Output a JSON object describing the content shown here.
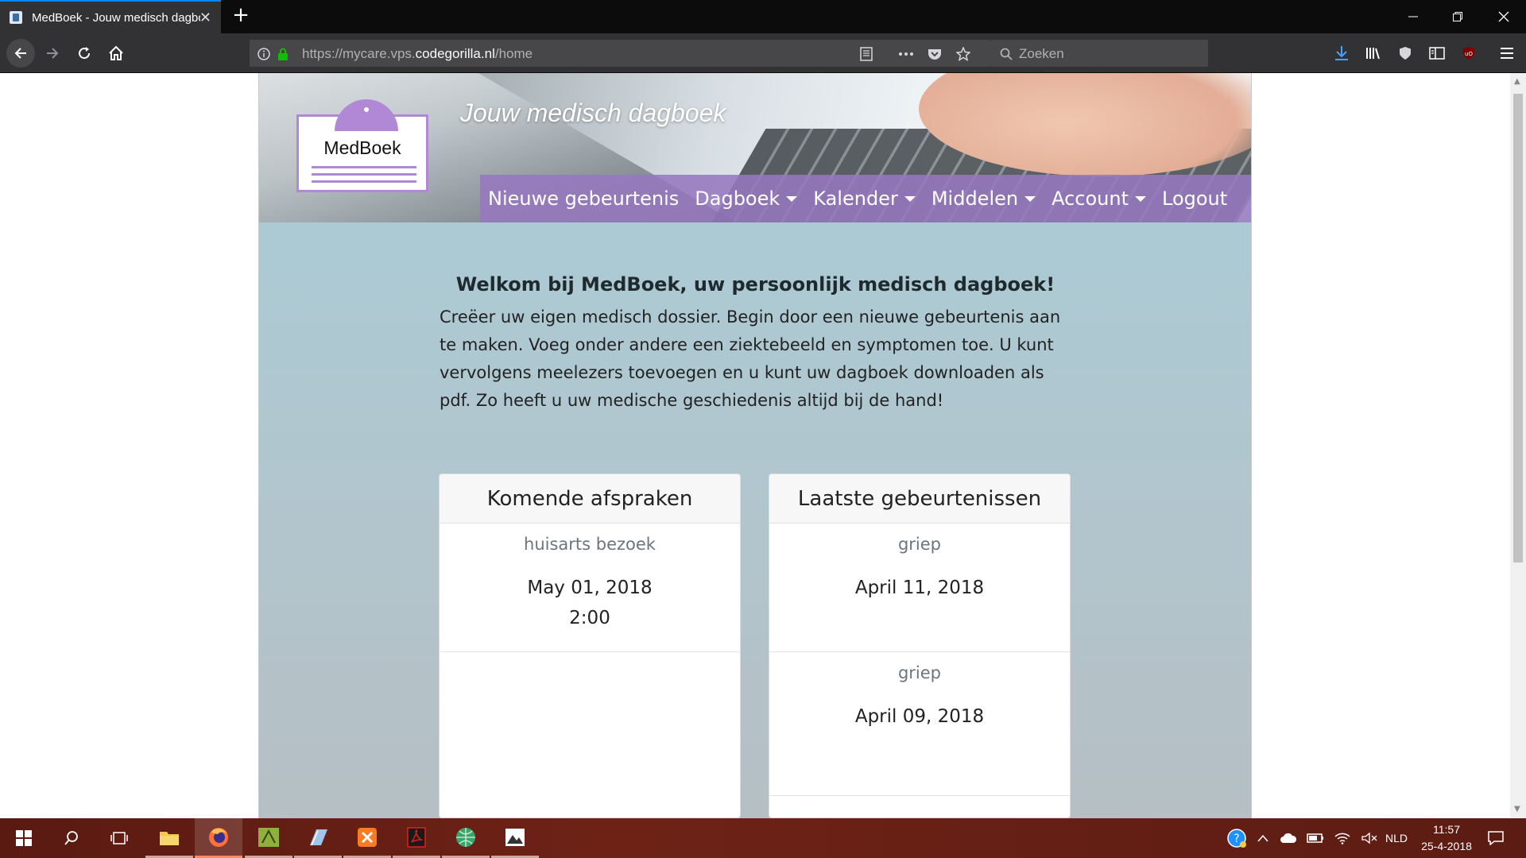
{
  "browser": {
    "tab_title": "MedBoek - Jouw medisch dagboek",
    "url_prefix": "https://mycare.vps.",
    "url_domain": "codegorilla.nl",
    "url_path": "/home",
    "search_placeholder": "Zoeken"
  },
  "site": {
    "logo_text": "MedBoek",
    "tagline": "Jouw medisch dagboek",
    "menu": [
      {
        "label": "Nieuwe gebeurtenis",
        "dropdown": false
      },
      {
        "label": "Dagboek",
        "dropdown": true
      },
      {
        "label": "Kalender",
        "dropdown": true
      },
      {
        "label": "Middelen",
        "dropdown": true
      },
      {
        "label": "Account",
        "dropdown": true
      },
      {
        "label": "Logout",
        "dropdown": false
      }
    ],
    "welcome_title": "Welkom bij MedBoek, uw persoonlijk medisch dagboek!",
    "intro_text": "Creëer uw eigen medisch dossier. Begin door een nieuwe gebeurtenis aan te maken. Voeg onder andere een ziektebeeld en symptomen toe. U kunt vervolgens meelezers toevoegen en u kunt uw dagboek downloaden als pdf. Zo heeft u uw medische geschiedenis altijd bij de hand!",
    "appointments": {
      "title": "Komende afspraken",
      "items": [
        {
          "title": "huisarts bezoek",
          "date": "May 01, 2018",
          "time": "2:00"
        }
      ]
    },
    "events": {
      "title": "Laatste gebeurtenissen",
      "items": [
        {
          "title": "griep",
          "date": "April 11, 2018"
        },
        {
          "title": "griep",
          "date": "April 09, 2018"
        }
      ]
    }
  },
  "taskbar": {
    "language": "NLD",
    "time": "11:57",
    "date": "25-4-2018"
  },
  "colors": {
    "accent": "#b188d6",
    "menu_bg": "#9678be",
    "firefox_blue": "#0a84ff"
  }
}
